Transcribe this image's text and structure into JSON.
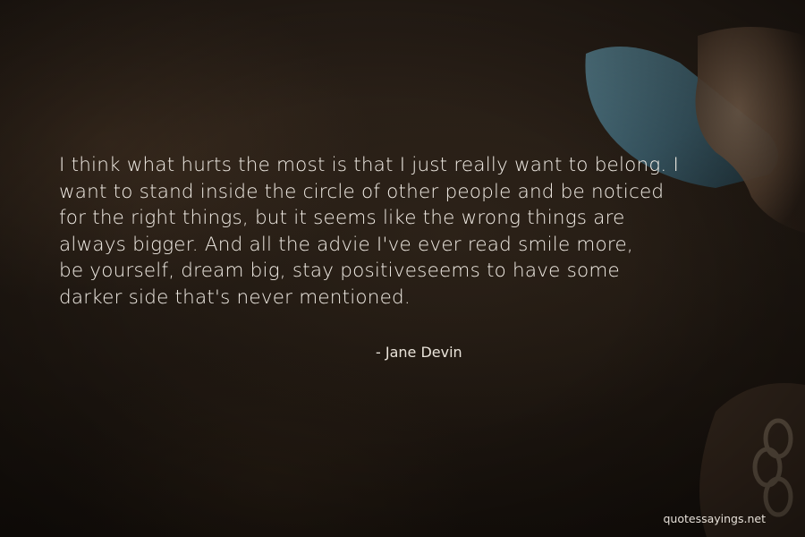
{
  "quote": {
    "text": "I think what hurts the most is that I just really want to belong. I\nwant to stand inside the circle of other people and be noticed\nfor the right things, but it seems like the wrong things are\nalways bigger. And all the advie I've ever read smile more,\nbe yourself, dream big, stay positiveseems to have some\ndarker side that's never mentioned.",
    "author": "- Jane Devin"
  },
  "watermark": "quotessayings.net",
  "colors": {
    "background": "#1c1510",
    "text": "#f2ede6"
  }
}
